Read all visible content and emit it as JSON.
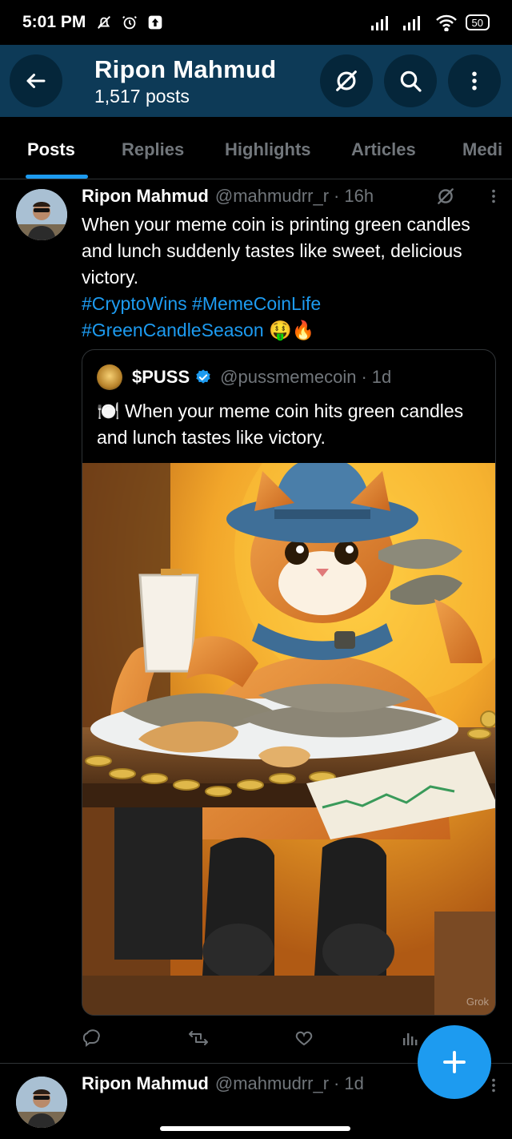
{
  "status_bar": {
    "time": "5:01 PM",
    "battery": "50"
  },
  "header": {
    "name": "Ripon Mahmud",
    "posts_count": "1,517 posts"
  },
  "tabs": [
    "Posts",
    "Replies",
    "Highlights",
    "Articles",
    "Medi"
  ],
  "post": {
    "author": "Ripon Mahmud",
    "handle": "@mahmudrr_r",
    "time": "16h",
    "text": "When your meme coin is printing green candles and lunch suddenly tastes like sweet, delicious victory.",
    "hashtags_line1": "#CryptoWins #MemeCoinLife",
    "hashtags_line2": "#GreenCandleSeason",
    "emojis": "🤑🔥",
    "quote": {
      "author": "$PUSS",
      "handle": "@pussmemecoin",
      "time": "1d",
      "text": "🍽️ When your meme coin hits green candles and lunch tastes like victory.",
      "watermark": "Grok"
    }
  },
  "next_post": {
    "author": "Ripon Mahmud",
    "handle": "@mahmudrr_r",
    "time": "1d"
  },
  "colors": {
    "header_bg": "#0d3a57",
    "accent": "#1d9bf0",
    "muted": "#71767b"
  }
}
